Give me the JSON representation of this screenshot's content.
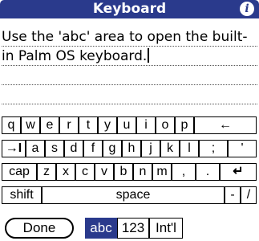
{
  "title": "Keyboard",
  "text_area": {
    "value": "Use the 'abc' area to open the built-in Palm OS keyboard."
  },
  "keyboard": {
    "row1": [
      "q",
      "w",
      "e",
      "r",
      "t",
      "y",
      "u",
      "i",
      "o",
      "p",
      "←"
    ],
    "row2": [
      "→I",
      "a",
      "s",
      "d",
      "f",
      "g",
      "h",
      "j",
      "k",
      "l",
      ";",
      "'"
    ],
    "row3": [
      "cap",
      "z",
      "x",
      "c",
      "v",
      "b",
      "n",
      "m",
      ",",
      ".",
      "↵"
    ],
    "row4": [
      "shift",
      "space",
      "-",
      "/"
    ]
  },
  "bottom": {
    "done_label": "Done",
    "modes": [
      "abc",
      "123",
      "Int'l"
    ],
    "active_mode": "abc"
  },
  "colors": {
    "accent": "#2a3a8c"
  }
}
